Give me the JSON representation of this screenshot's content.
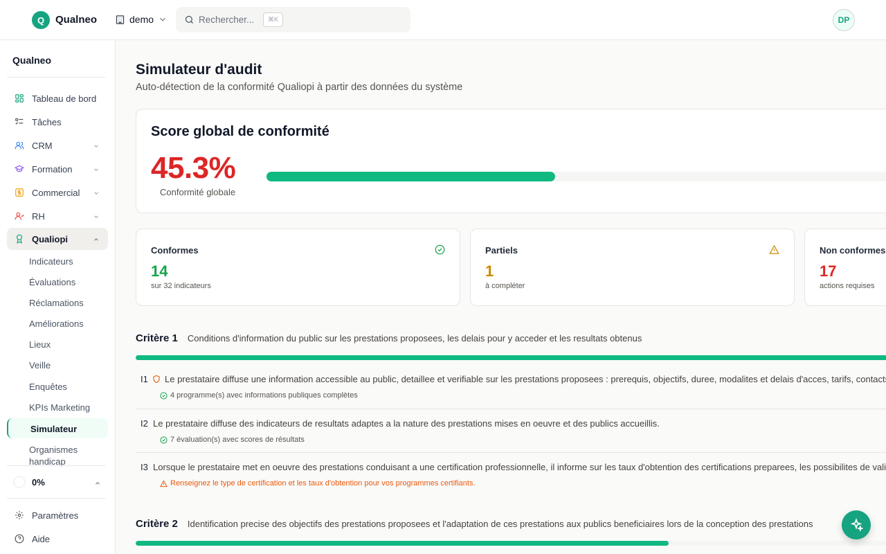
{
  "topbar": {
    "logo_letter": "Q",
    "app_name": "Qualneo",
    "workspace": "demo",
    "search_placeholder": "Rechercher...",
    "search_shortcut": "⌘K",
    "avatar_initials": "DP"
  },
  "sidebar": {
    "brand": "Qualneo",
    "items": [
      {
        "label": "Tableau de bord",
        "icon": "dashboard-icon",
        "color": "#16a37f"
      },
      {
        "label": "Tâches",
        "icon": "tasks-icon",
        "color": "#57534e"
      },
      {
        "label": "CRM",
        "icon": "users-icon",
        "color": "#3b82f6"
      },
      {
        "label": "Formation",
        "icon": "graduation-cap-icon",
        "color": "#8b5cf6"
      },
      {
        "label": "Commercial",
        "icon": "dollar-icon",
        "color": "#f59e0b"
      },
      {
        "label": "RH",
        "icon": "people-icon",
        "color": "#ef4444"
      },
      {
        "label": "Qualiopi",
        "icon": "award-icon",
        "color": "#16a37f"
      }
    ],
    "subitems": [
      "Indicateurs",
      "Évaluations",
      "Réclamations",
      "Améliorations",
      "Lieux",
      "Veille",
      "Enquêtes",
      "KPIs Marketing",
      "Simulateur",
      "Organismes handicap"
    ],
    "progress_label": "0%",
    "progress_value": 0,
    "footer": [
      {
        "label": "Paramètres",
        "icon": "gear-icon"
      },
      {
        "label": "Aide",
        "icon": "help-icon"
      }
    ]
  },
  "main": {
    "title": "Simulateur d'audit",
    "subtitle": "Auto-détection de la conformité Qualiopi à partir des données du système",
    "score": {
      "heading": "Score global de conformité",
      "value": "45.3%",
      "fraction": 0.453,
      "caption": "Conformité globale",
      "color": "#dc2626"
    },
    "stats": [
      {
        "title": "Conformes",
        "value": "14",
        "sub": "sur 32 indicateurs",
        "color": "#16a34a",
        "icon": "check-circle-icon"
      },
      {
        "title": "Partiels",
        "value": "1",
        "sub": "à compléter",
        "color": "#ca8a04",
        "icon": "warning-icon"
      },
      {
        "title": "Non conformes",
        "value": "17",
        "sub": "actions requises",
        "color": "#dc2626",
        "icon": "x-circle-icon"
      }
    ],
    "criteria": [
      {
        "label": "Critère 1",
        "desc": "Conditions d'information du public sur les prestations proposees, les delais pour y acceder et les resultats obtenus",
        "progress": 1.0,
        "indicators": [
          {
            "code": "I1",
            "text": "Le prestataire diffuse une information accessible au public, detaillee et verifiable sur les prestations proposees : prerequis, objectifs, duree, modalites et delais d'acces, tarifs, contacts, methodes mobilisees et modalites d'evaluation, accessibilite aux personnes handicapees.",
            "note": "4 programme(s) avec informations publiques complètes",
            "status": "ok",
            "badge": "shield-icon"
          },
          {
            "code": "I2",
            "text": "Le prestataire diffuse des indicateurs de resultats adaptes a la nature des prestations mises en oeuvre et des publics accueillis.",
            "note": "7 évaluation(s) avec scores de résultats",
            "status": "ok"
          },
          {
            "code": "I3",
            "text": "Lorsque le prestataire met en oeuvre des prestations conduisant a une certification professionnelle, il informe sur les taux d'obtention des certifications preparees, les possibilites de valider un/ou des blocs de competences.",
            "note": "Renseignez le type de certification et les taux d'obtention pour vos programmes certifiants.",
            "status": "warn"
          }
        ]
      },
      {
        "label": "Critère 2",
        "desc": "Identification precise des objectifs des prestations proposees et l'adaptation de ces prestations aux publics beneficiaires lors de la conception des prestations",
        "progress": 0.7
      }
    ]
  },
  "colors": {
    "accent": "#16a37f",
    "ok": "#16a34a",
    "warn": "#ea580c",
    "danger": "#dc2626"
  },
  "fab_icon": "sparkles-icon"
}
